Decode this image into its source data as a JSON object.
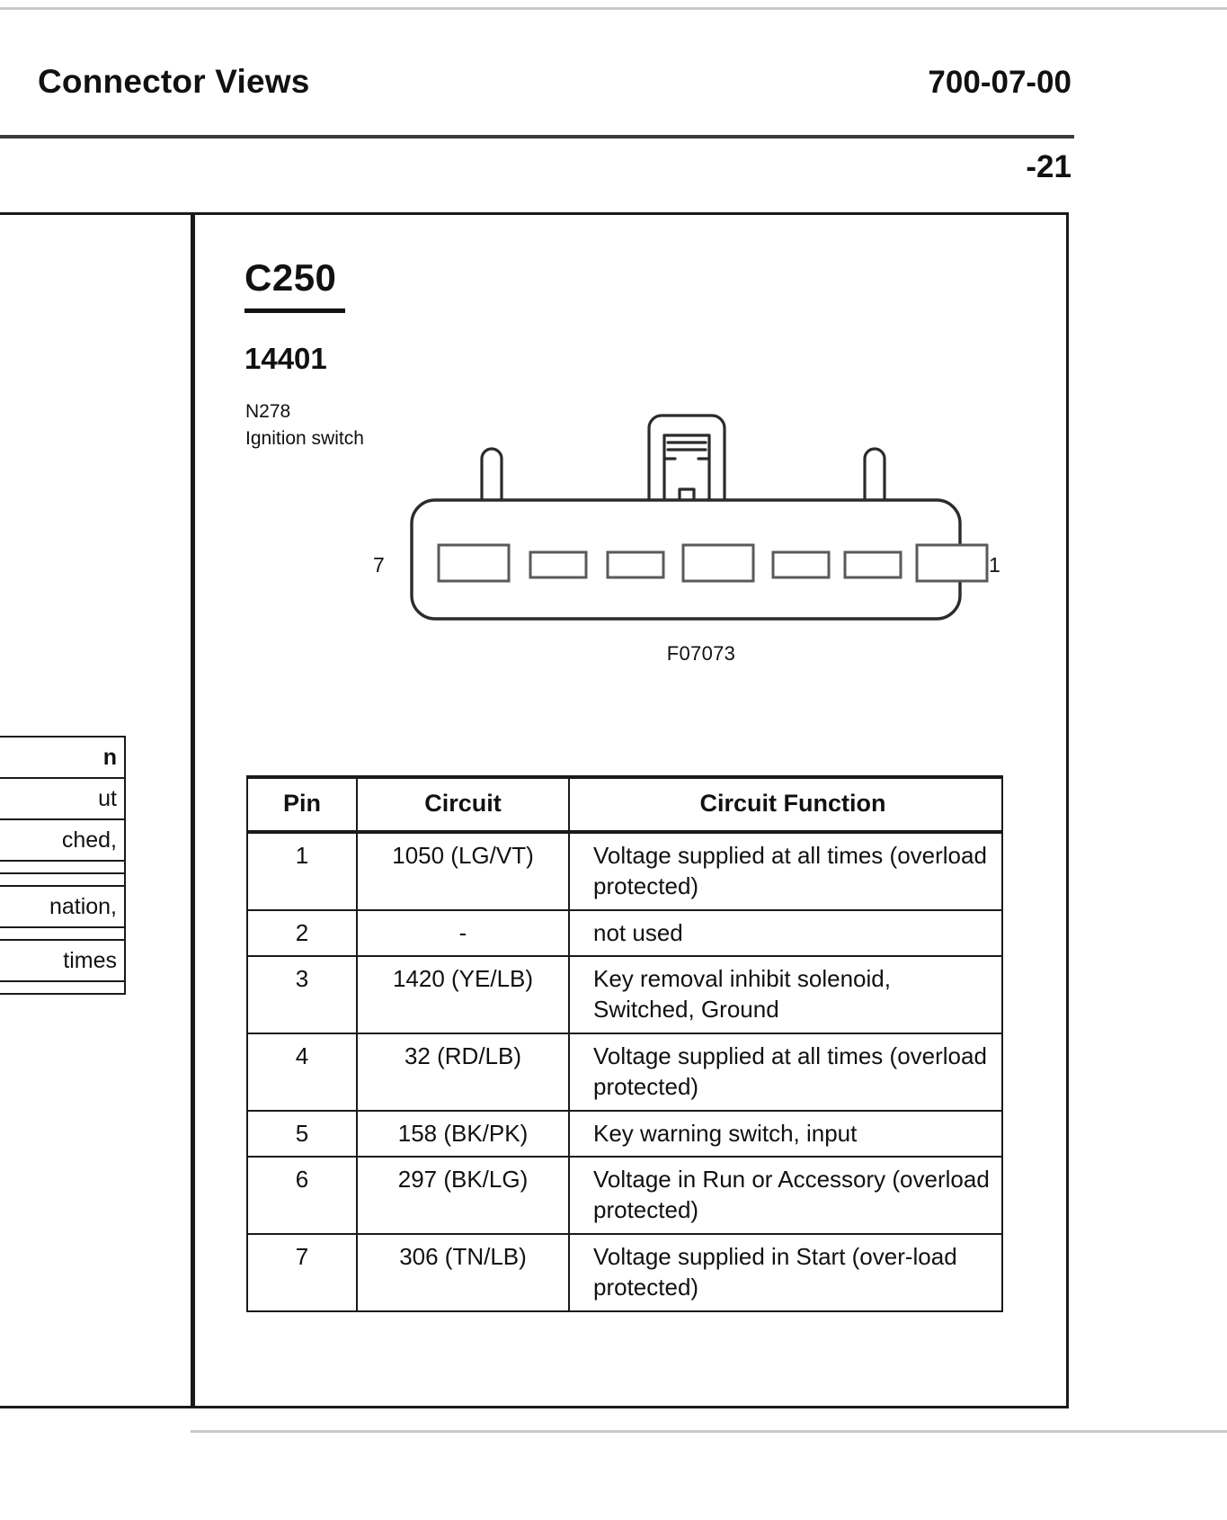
{
  "header": {
    "title": "Connector Views",
    "section_code": "700-07-00",
    "page_number": "-21"
  },
  "connector": {
    "id": "C250",
    "part_number": "14401",
    "ref_designator": "N278",
    "description": "Ignition switch",
    "figure_number": "F07073",
    "pin_label_left": "7",
    "pin_label_right": "1",
    "cavity_count": 7
  },
  "pin_table": {
    "columns": [
      "Pin",
      "Circuit",
      "Circuit Function"
    ],
    "rows": [
      {
        "pin": "1",
        "circuit": "1050 (LG/VT)",
        "function": "Voltage supplied at all times (overload protected)"
      },
      {
        "pin": "2",
        "circuit": "-",
        "function": "not used"
      },
      {
        "pin": "3",
        "circuit": "1420 (YE/LB)",
        "function": "Key removal inhibit solenoid, Switched, Ground"
      },
      {
        "pin": "4",
        "circuit": "32 (RD/LB)",
        "function": "Voltage supplied at all times (overload protected)"
      },
      {
        "pin": "5",
        "circuit": "158 (BK/PK)",
        "function": "Key warning switch, input"
      },
      {
        "pin": "6",
        "circuit": "297 (BK/LG)",
        "function": "Voltage in Run or Accessory (overload protected)"
      },
      {
        "pin": "7",
        "circuit": "306 (TN/LB)",
        "function": "Voltage supplied in Start (over-load protected)"
      }
    ]
  },
  "left_partial_table": {
    "rows": [
      "n",
      "ut",
      "ched,",
      "",
      "",
      "nation,",
      "",
      "times",
      ""
    ]
  }
}
